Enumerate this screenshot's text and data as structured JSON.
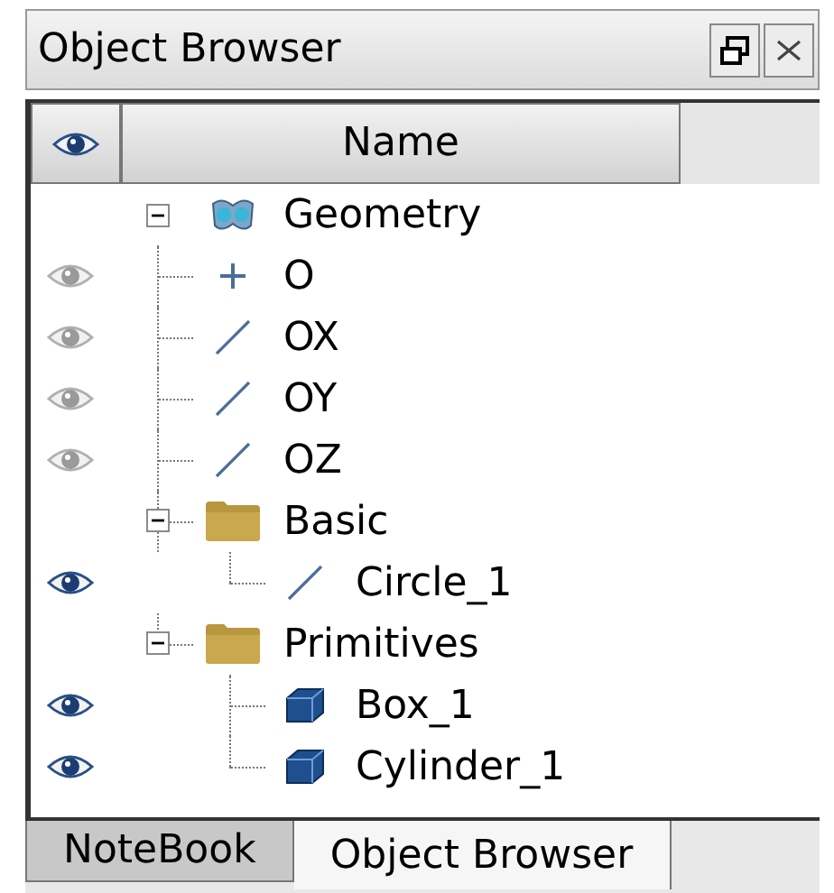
{
  "window": {
    "title": "Object Browser"
  },
  "columns": [
    {
      "kind": "eye"
    },
    {
      "kind": "text",
      "label": "Name"
    }
  ],
  "tree": [
    {
      "name": "Geometry",
      "kind": "component",
      "expanded": true,
      "children": [
        {
          "name": "O",
          "kind": "point",
          "visible": false
        },
        {
          "name": "OX",
          "kind": "line",
          "visible": false
        },
        {
          "name": "OY",
          "kind": "line",
          "visible": false
        },
        {
          "name": "OZ",
          "kind": "line",
          "visible": false
        },
        {
          "name": "Basic",
          "kind": "folder",
          "expanded": true,
          "children": [
            {
              "name": "Circle_1",
              "kind": "line",
              "visible": true
            }
          ]
        },
        {
          "name": "Primitives",
          "kind": "folder",
          "expanded": true,
          "children": [
            {
              "name": "Box_1",
              "kind": "solid",
              "visible": true
            },
            {
              "name": "Cylinder_1",
              "kind": "solid",
              "visible": true
            }
          ]
        }
      ]
    }
  ],
  "tabs": [
    {
      "label": "NoteBook",
      "selected": false
    },
    {
      "label": "Object Browser",
      "selected": true
    }
  ]
}
